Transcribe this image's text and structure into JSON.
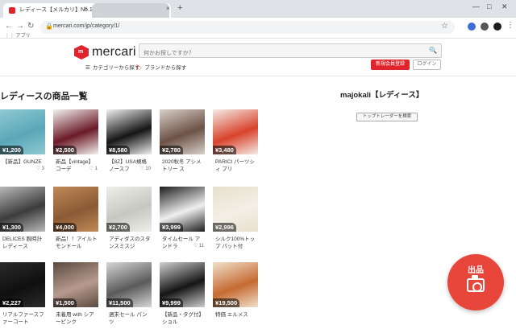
{
  "browser": {
    "tab_title": "レディース【メルカリ】No.1フリマ",
    "other_tab_title": "",
    "tab_close": "×",
    "new_tab": "+",
    "url": "mercari.com/jp/category/1/",
    "bookmarks_apps": "アプリ"
  },
  "header": {
    "logo_text": "mercari",
    "search_placeholder": "何かお探しですか？",
    "category_link": "カテゴリーから探す",
    "brand_link": "ブランドから探す",
    "signup": "新規会員登録",
    "login": "ログイン"
  },
  "main": {
    "page_title": "レディースの商品一覧",
    "items": [
      {
        "price": "¥1,200",
        "title": "【新品】GUNZE",
        "likes": "3",
        "colors": [
          "#5aa7b8",
          "#8fc9d2"
        ]
      },
      {
        "price": "¥2,500",
        "title": "新品【vintage】コーデ",
        "likes": "1",
        "colors": [
          "#6b1a27",
          "#f4f1ee"
        ]
      },
      {
        "price": "¥8,580",
        "title": "【8Z】USA規格 ノースフ",
        "likes": "10",
        "colors": [
          "#151515",
          "#f0f0f0"
        ]
      },
      {
        "price": "¥2,780",
        "title": "2020秋冬 アシメトリー ス",
        "likes": "",
        "colors": [
          "#6d5246",
          "#d8d0c8"
        ]
      },
      {
        "price": "¥3,480",
        "title": "PARICI パーツシィ プリ",
        "likes": "",
        "colors": [
          "#d8432c",
          "#f4ece6"
        ]
      },
      {
        "price": "¥1,300",
        "title": "DELICES 腕時計 レディース",
        "likes": "",
        "colors": [
          "#3c3c3c",
          "#b9b9b9"
        ]
      },
      {
        "price": "¥4,000",
        "title": "新品！！アイルトモンドール",
        "likes": "",
        "colors": [
          "#8a5a34",
          "#c08a58"
        ]
      },
      {
        "price": "¥2,700",
        "title": "アディダスのスタンスミスジ",
        "likes": "",
        "colors": [
          "#c7c7c2",
          "#efefe9"
        ]
      },
      {
        "price": "¥3,999",
        "title": "タイムセール アンドラ",
        "likes": "11",
        "colors": [
          "#efefef",
          "#1d1d1d"
        ]
      },
      {
        "price": "¥2,996",
        "title": "シルク100%トップ パット付",
        "likes": "",
        "colors": [
          "#f3efe6",
          "#e8e0cc"
        ]
      },
      {
        "price": "¥2,227",
        "title": "リアルファースファーコート",
        "likes": "",
        "colors": [
          "#0f0f0f",
          "#2b2b2b"
        ]
      },
      {
        "price": "¥1,500",
        "title": "未着用 with シアーピンク",
        "likes": "",
        "colors": [
          "#b79a8d",
          "#5a4a40"
        ]
      },
      {
        "price": "¥11,500",
        "title": "週末セール パンツ",
        "likes": "",
        "colors": [
          "#5a5a5a",
          "#d7d7d7"
        ]
      },
      {
        "price": "¥9,999",
        "title": "【新品・タグ付】ショル",
        "likes": "",
        "colors": [
          "#151515",
          "#cfcfcf"
        ]
      },
      {
        "price": "¥19,500",
        "title": "特価 エルメス",
        "likes": "",
        "colors": [
          "#c56a32",
          "#f1e1cc"
        ]
      }
    ]
  },
  "sidebar": {
    "title": "majokali【レディース】",
    "button": "トップトレーダーを検索"
  },
  "fab": {
    "label": "出品"
  },
  "accent_color": "#e0242c"
}
